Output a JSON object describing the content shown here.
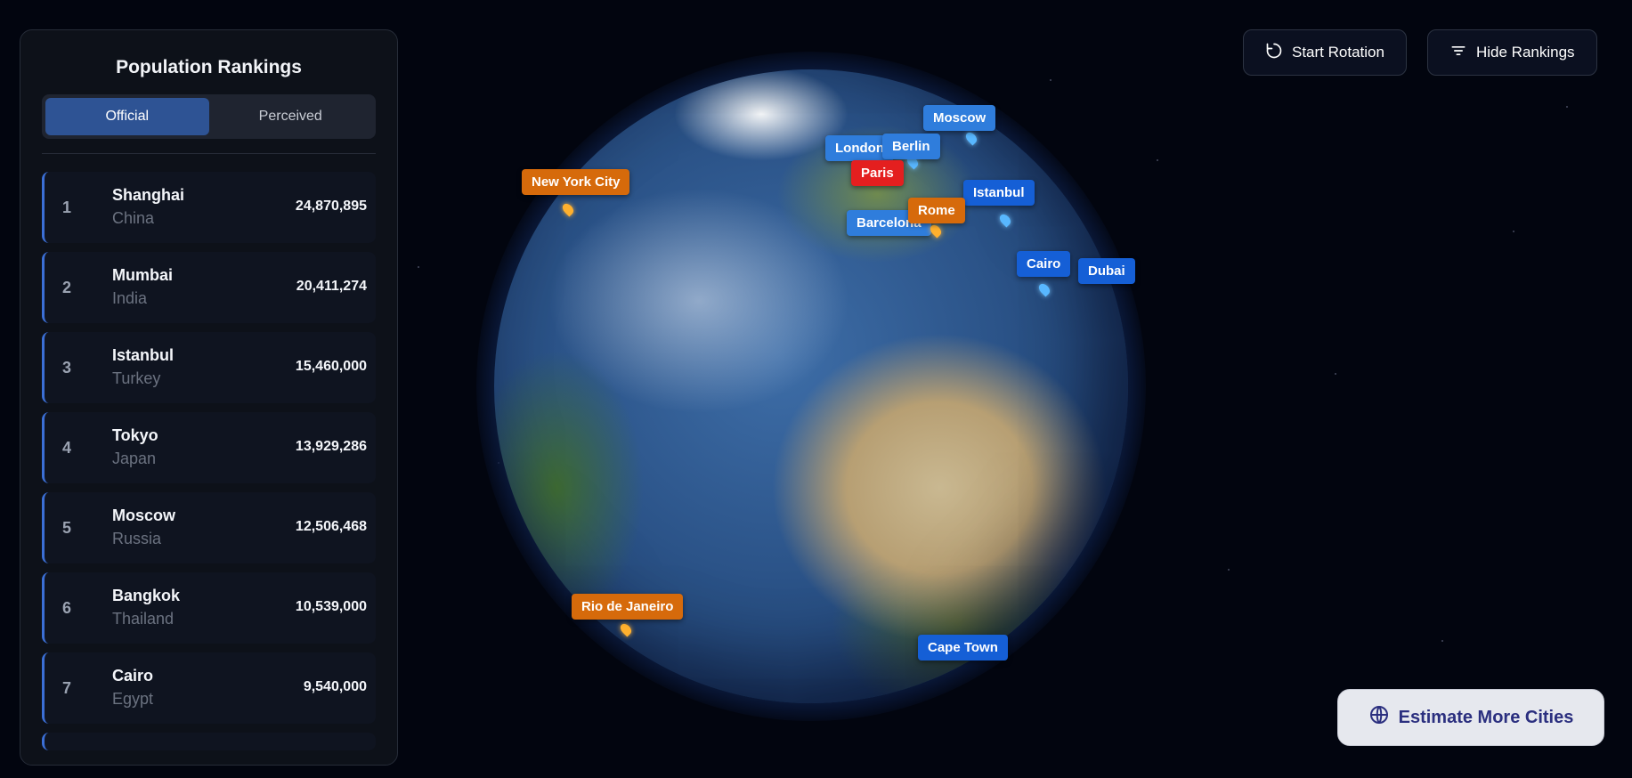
{
  "rankings": {
    "title": "Population Rankings",
    "tabs": [
      {
        "label": "Official",
        "active": true
      },
      {
        "label": "Perceived",
        "active": false
      }
    ],
    "items": [
      {
        "rank": "1",
        "city": "Shanghai",
        "country": "China",
        "population": "24,870,895"
      },
      {
        "rank": "2",
        "city": "Mumbai",
        "country": "India",
        "population": "20,411,274"
      },
      {
        "rank": "3",
        "city": "Istanbul",
        "country": "Turkey",
        "population": "15,460,000"
      },
      {
        "rank": "4",
        "city": "Tokyo",
        "country": "Japan",
        "population": "13,929,286"
      },
      {
        "rank": "5",
        "city": "Moscow",
        "country": "Russia",
        "population": "12,506,468"
      },
      {
        "rank": "6",
        "city": "Bangkok",
        "country": "Thailand",
        "population": "10,539,000"
      },
      {
        "rank": "7",
        "city": "Cairo",
        "country": "Egypt",
        "population": "9,540,000"
      }
    ]
  },
  "controls": {
    "rotation_label": "Start Rotation",
    "rankings_toggle_label": "Hide Rankings",
    "estimate_label": "Estimate More Cities"
  },
  "map_labels": {
    "moscow": "Moscow",
    "london": "London",
    "berlin": "Berlin",
    "paris": "Paris",
    "new_york": "New York City",
    "istanbul": "Istanbul",
    "rome": "Rome",
    "barcelona": "Barcelona",
    "cairo": "Cairo",
    "dubai": "Dubai",
    "rio": "Rio de Janeiro",
    "cape_town": "Cape Town"
  },
  "colors": {
    "accent_blue": "#2e5394",
    "pin_blue": "#2f7ddc",
    "pin_orange": "#d66a0b",
    "pin_red": "#e41f1f"
  }
}
